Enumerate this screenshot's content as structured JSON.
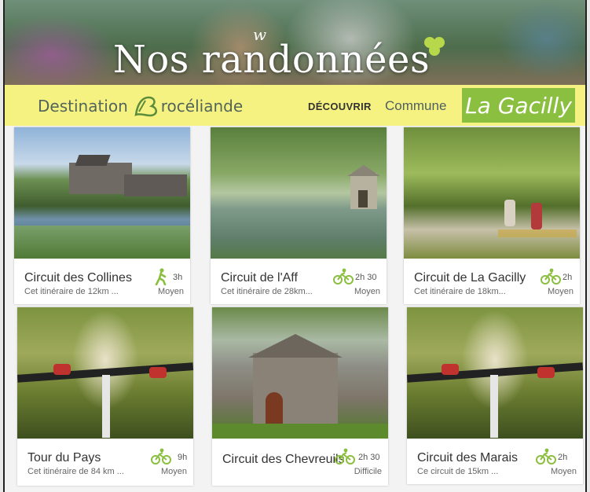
{
  "hero": {
    "title": "Nos randonnées",
    "logo_mark": "w"
  },
  "nav": {
    "brand_text_1": "Destination",
    "brand_text_2": "rocéliande",
    "discover": "DÉCOUVRIR",
    "commune": "Commune",
    "commune_name": "La Gacilly"
  },
  "colors": {
    "nav_bg": "#f5f282",
    "accent_green": "#8bbf3f"
  },
  "cards": [
    {
      "name": "Circuit des Collines",
      "desc": "Cet itinéraire de 12km ...",
      "icon": "hiker-icon",
      "duration": "3h",
      "level": "Moyen"
    },
    {
      "name": "Circuit de l'Aff",
      "desc": "Cet itinéraire de 28km...",
      "icon": "bike-icon",
      "duration": "2h 30",
      "level": "Moyen"
    },
    {
      "name": "Circuit de La Gacilly",
      "desc": "Cet itinéraire de 18km...",
      "icon": "bike-icon",
      "duration": "2h",
      "level": "Moyen"
    },
    {
      "name": "Tour du Pays",
      "desc": "Cet itinéraire de 84 km ...",
      "icon": "bike-icon",
      "duration": "9h",
      "level": "Moyen"
    },
    {
      "name": "Circuit des Chevreuils",
      "desc": "",
      "icon": "bike-icon",
      "duration": "2h 30",
      "level": "Difficile"
    },
    {
      "name": "Circuit des Marais",
      "desc": "Ce circuit de 15km ...",
      "icon": "bike-icon",
      "duration": "2h",
      "level": "Moyen"
    }
  ]
}
